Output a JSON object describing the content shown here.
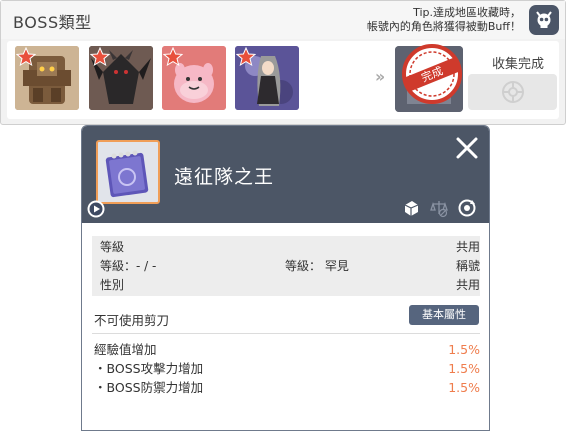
{
  "collection": {
    "title": "BOSS類型",
    "tip_line1": "Tip.達成地區收藏時，",
    "tip_line2": "帳號內的角色將獲得被動Buff！",
    "bosses": [
      {
        "name": "boss-golem",
        "color": "#8a6a4a"
      },
      {
        "name": "boss-dark-dragon",
        "color": "#2f2d30"
      },
      {
        "name": "boss-pink-bean",
        "color": "#d98a8a"
      },
      {
        "name": "boss-magician",
        "color": "#8a82b6"
      }
    ],
    "stamp_text": "完成",
    "collect_complete_label": "收集完成"
  },
  "item": {
    "name": "遠征隊之王",
    "requirements": {
      "level_label": "等級",
      "level_value": "共用",
      "level_line": "等級：- / -",
      "rarity_line": "等級： 罕見",
      "type_value": "稱號",
      "gender_label": "性別",
      "gender_value": "共用"
    },
    "no_scissors": "不可使用剪刀",
    "basic_attr_button": "基本屬性",
    "stats": [
      {
        "label": "經驗值增加",
        "value": "1.5%"
      },
      {
        "label": "・BOSS攻擊力增加",
        "value": "1.5%"
      },
      {
        "label": "・BOSS防禦力增加",
        "value": "1.5%"
      }
    ]
  },
  "colors": {
    "tooltip_header": "#4c5666",
    "stat_value": "#ef7d4d",
    "item_frame": "#f09e58",
    "stamp_red": "#cf3a2c"
  }
}
